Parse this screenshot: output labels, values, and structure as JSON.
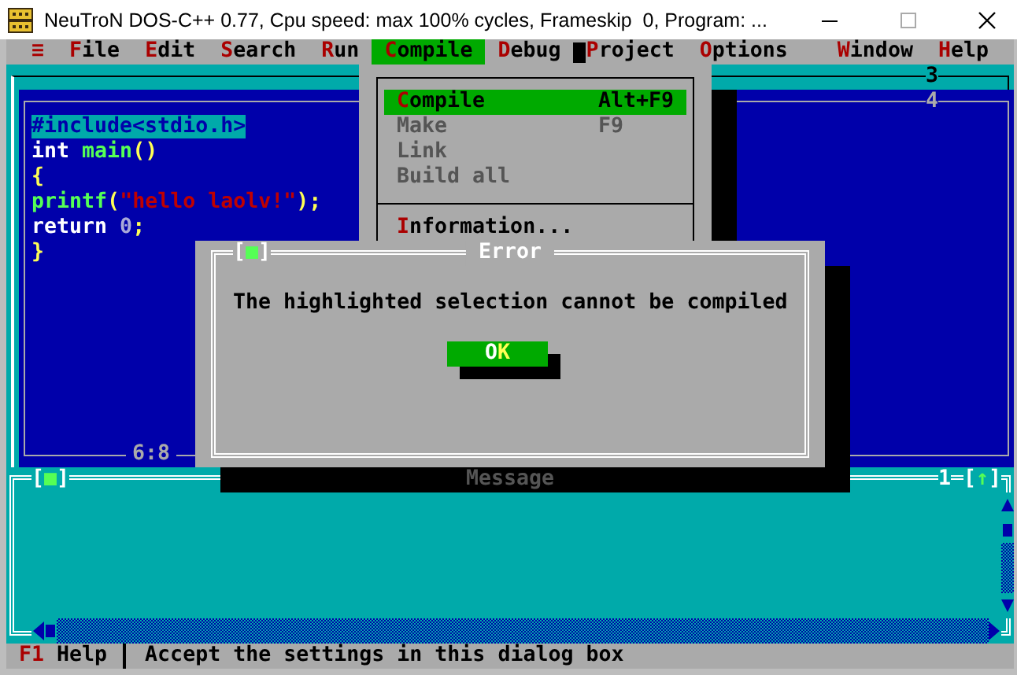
{
  "window": {
    "title": "NeuTroN DOS-C++ 0.77, Cpu speed: max 100% cycles, Frameskip  0, Program: ..."
  },
  "menu_bar": {
    "left": [
      {
        "label": "**≡**",
        "selected": false
      },
      {
        "label": "**F**ile",
        "selected": false
      },
      {
        "label": "**E**dit",
        "selected": false
      },
      {
        "label": "**S**earch",
        "selected": false
      },
      {
        "label": "**R**un",
        "selected": false
      },
      {
        "label": "**C**ompile",
        "selected": true
      },
      {
        "label": "**D**ebug",
        "selected": false
      },
      {
        "label": "**P**roject",
        "selected": false
      },
      {
        "label": "**O**ptions",
        "selected": false
      }
    ],
    "right": [
      {
        "label": "**W**indow",
        "selected": false
      },
      {
        "label": "**H**elp",
        "selected": false
      }
    ]
  },
  "back_window": {
    "number": "3"
  },
  "editor": {
    "number": "4",
    "cursor_position": "6:8",
    "lines": [
      {
        "selected": true,
        "tokens": [
          {
            "text": "#include<stdio.h>",
            "kind": "preprocessor"
          }
        ]
      },
      {
        "selected": false,
        "tokens": [
          {
            "text": "int ",
            "kind": "keyword"
          },
          {
            "text": "main",
            "kind": "function"
          },
          {
            "text": "()",
            "kind": "punctuation"
          }
        ]
      },
      {
        "selected": false,
        "tokens": [
          {
            "text": "{",
            "kind": "punctuation"
          }
        ]
      },
      {
        "selected": false,
        "tokens": [
          {
            "text": "printf",
            "kind": "function"
          },
          {
            "text": "(",
            "kind": "punctuation"
          },
          {
            "text": "\"hello laolv!\"",
            "kind": "string"
          },
          {
            "text": ");",
            "kind": "punctuation"
          }
        ]
      },
      {
        "selected": false,
        "tokens": [
          {
            "text": "return ",
            "kind": "keyword"
          },
          {
            "text": "0",
            "kind": "number"
          },
          {
            "text": ";",
            "kind": "punctuation"
          }
        ]
      },
      {
        "selected": false,
        "tokens": [
          {
            "text": "}",
            "kind": "punctuation"
          }
        ]
      }
    ]
  },
  "compile_menu": {
    "items": [
      {
        "kind": "item",
        "label": "**C**ompile",
        "shortcut": "Alt+F9",
        "selected": true,
        "disabled": false
      },
      {
        "kind": "item",
        "label": "Make",
        "shortcut": "F9",
        "selected": false,
        "disabled": true
      },
      {
        "kind": "item",
        "label": "Link",
        "selected": false,
        "disabled": true
      },
      {
        "kind": "item",
        "label": "Build all",
        "selected": false,
        "disabled": true
      },
      {
        "kind": "separator"
      },
      {
        "kind": "item",
        "label": "**I**nformation...",
        "selected": false,
        "disabled": false
      }
    ]
  },
  "dialog": {
    "title": "Error",
    "close_box": "[**■**]",
    "message": "The highlighted selection cannot be compiled",
    "button": "O**K**"
  },
  "message_window": {
    "title": "Message",
    "close_box": "[**■**]",
    "number": "1",
    "zoom_box": "[**↑**]"
  },
  "status_bar": {
    "key": "F1",
    "key_label": "Help",
    "hint": "Accept the settings in this dialog box"
  }
}
